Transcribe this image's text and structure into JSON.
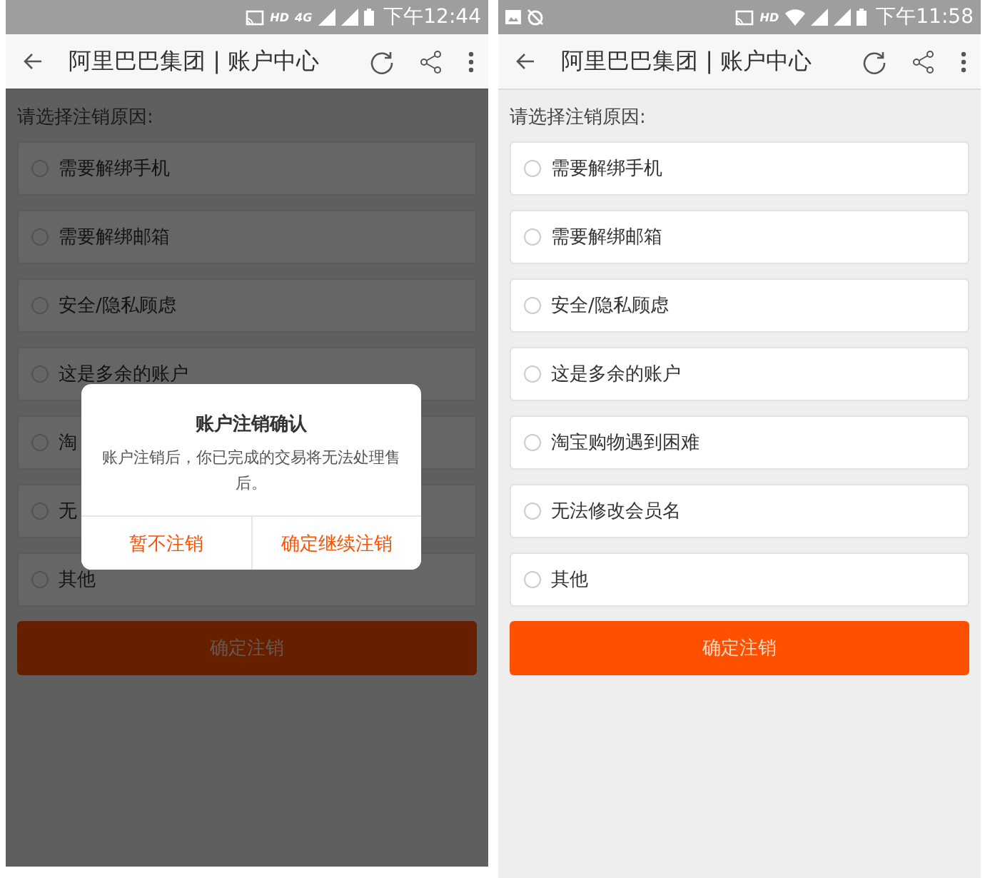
{
  "phones": [
    {
      "status_bar": {
        "icons": [
          {
            "kind": "cast"
          },
          {
            "kind": "text",
            "text": "HD"
          },
          {
            "kind": "text",
            "text": "4G"
          },
          {
            "kind": "signal"
          },
          {
            "kind": "signal"
          },
          {
            "kind": "battery"
          }
        ],
        "time": "下午12:44"
      },
      "toolbar": {
        "title": "阿里巴巴集团 | 账户中心"
      },
      "prompt": "请选择注销原因:",
      "options": [
        {
          "label": "需要解绑手机",
          "selected": false
        },
        {
          "label": "需要解绑邮箱",
          "selected": false
        },
        {
          "label": "安全/隐私顾虑",
          "selected": false
        },
        {
          "label": "这是多余的账户",
          "selected": false
        },
        {
          "label": "淘",
          "selected": false
        },
        {
          "label": "无",
          "selected": false
        },
        {
          "label": "其他",
          "selected": false
        }
      ],
      "submit_button": "确定注销",
      "dialog": {
        "title": "账户注销确认",
        "message": "账户注销后，你已完成的交易将无法处理售后。",
        "cancel_button": "暂不注销",
        "confirm_button": "确定继续注销"
      }
    },
    {
      "status_bar": {
        "icons": [
          {
            "kind": "image"
          },
          {
            "kind": "clock"
          },
          {
            "kind": "spacer"
          },
          {
            "kind": "cast"
          },
          {
            "kind": "text",
            "text": "HD"
          },
          {
            "kind": "wifi"
          },
          {
            "kind": "signal"
          },
          {
            "kind": "signal"
          },
          {
            "kind": "battery"
          }
        ],
        "time": "下午11:58"
      },
      "toolbar": {
        "title": "阿里巴巴集团 | 账户中心"
      },
      "prompt": "请选择注销原因:",
      "options": [
        {
          "label": "需要解绑手机",
          "selected": false
        },
        {
          "label": "需要解绑邮箱",
          "selected": false
        },
        {
          "label": "安全/隐私顾虑",
          "selected": false
        },
        {
          "label": "这是多余的账户",
          "selected": false
        },
        {
          "label": "淘宝购物遇到困难",
          "selected": false
        },
        {
          "label": "无法修改会员名",
          "selected": false
        },
        {
          "label": "其他",
          "selected": false
        }
      ],
      "submit_button": "确定注销"
    }
  ]
}
